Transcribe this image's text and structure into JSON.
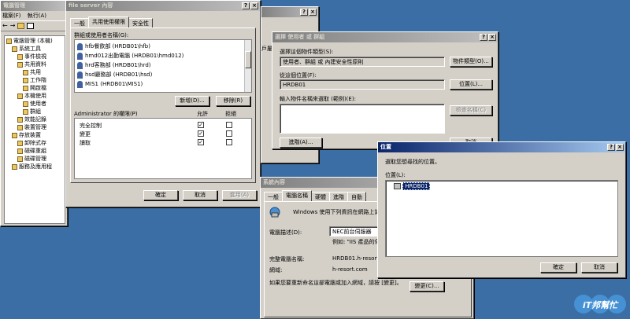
{
  "mmc": {
    "title": "電腦管理",
    "menu": [
      "檔案(F)",
      "執行(A)"
    ],
    "tree": [
      {
        "label": "電腦管理 (本機)",
        "indent": 0
      },
      {
        "label": "系統工具",
        "indent": 1
      },
      {
        "label": "事件檢視",
        "indent": 2
      },
      {
        "label": "共用資料",
        "indent": 2
      },
      {
        "label": "共用",
        "indent": 3
      },
      {
        "label": "工作階",
        "indent": 3
      },
      {
        "label": "開啟檔",
        "indent": 3
      },
      {
        "label": "本機使用",
        "indent": 2
      },
      {
        "label": "使用者",
        "indent": 3
      },
      {
        "label": "群組",
        "indent": 3
      },
      {
        "label": "效能記錄",
        "indent": 2
      },
      {
        "label": "裝置管理",
        "indent": 2
      },
      {
        "label": "存放裝置",
        "indent": 1
      },
      {
        "label": "卸除式存",
        "indent": 2
      },
      {
        "label": "磁碟重組",
        "indent": 2
      },
      {
        "label": "磁碟管理",
        "indent": 2
      },
      {
        "label": "服務及應用程",
        "indent": 1
      }
    ],
    "partial_header": "戶屬"
  },
  "fileserver": {
    "title": "file server 內容",
    "tabs": [
      "一般",
      "共用使用權限",
      "安全性"
    ],
    "active_tab": 1,
    "names_label": "群組或使用者名稱(G):",
    "names": [
      "hfb餐飲部 (HRDB01\\hfb)",
      "hmd012出勤電腦 (HRDB01\\hmd012)",
      "hrd客務部 (HRDB01\\hrd)",
      "hsd廳務部 (HRDB01\\hsd)",
      "MIS1 (HRDB01\\MIS1)"
    ],
    "add": "新增(D)...",
    "remove": "移除(R)",
    "perm_label": "Administrator 的權限(P)",
    "allow": "允許",
    "deny": "拒絕",
    "perms": [
      {
        "name": "完全控制",
        "allow": true,
        "deny": false
      },
      {
        "name": "變更",
        "allow": true,
        "deny": false
      },
      {
        "name": "讀取",
        "allow": true,
        "deny": false
      }
    ],
    "ok": "確定",
    "cancel": "取消",
    "apply": "套用(A)"
  },
  "select_users": {
    "title": "選擇 使用者 或 群組",
    "object_type_label": "選擇這個物件類型(S):",
    "object_type_value": "使用者、群組 或 內建安全性原則",
    "object_type_btn": "物件類型(O)...",
    "location_label": "從這個位置(F):",
    "location_value": "HRDB01",
    "location_btn": "位置(L)...",
    "names_label": "輸入物件名稱來選取 (範例)(E):",
    "example_link": "範例",
    "check_btn": "檢查名稱(C)",
    "advanced_btn": "進階(A)...",
    "cancel": "取消"
  },
  "system_props": {
    "title": "系統內容",
    "tabs": [
      "一般",
      "電腦名稱",
      "硬體",
      "進階",
      "自動"
    ],
    "active_tab": 1,
    "intro": "Windows 使用下列資訊在網路上識",
    "desc_label": "電腦描述(D):",
    "desc_value": "NEC前台伺服器",
    "example": "例如: \"IIS 產品的伺",
    "fullname_label": "完整電腦名稱:",
    "fullname_value": "HRDB01.h-resort.com",
    "domain_label": "網域:",
    "domain_value": "h-resort.com",
    "rename_text": "如果您要重新命名這部電腦或加入網域，請按 [變更]。",
    "change_btn": "變更(C)..."
  },
  "location": {
    "title": "位置",
    "prompt": "選取您想尋找的位置。",
    "label": "位置(L):",
    "item": "HRDB01",
    "ok": "確定",
    "cancel": "取消"
  },
  "watermark": {
    "text": "iT邦幫忙"
  },
  "colors": {
    "desktop": "#3a6ea5",
    "title_active": "#0a246a",
    "title_inactive": "#808080",
    "face": "#d4d0c8"
  }
}
